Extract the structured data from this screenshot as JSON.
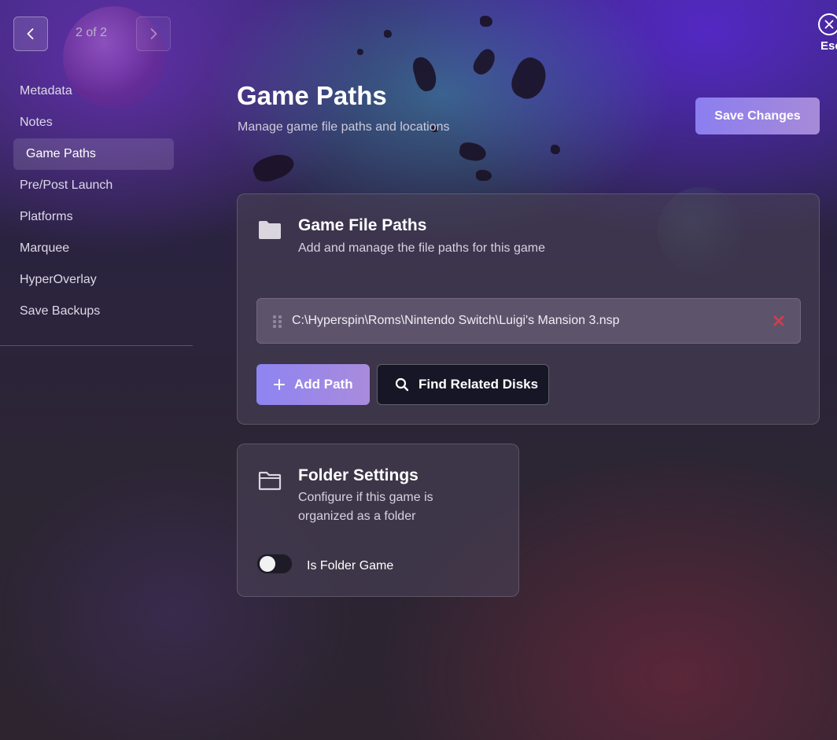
{
  "nav": {
    "counter": "2 of 2",
    "esc_label": "Esc"
  },
  "sidebar": {
    "items": [
      {
        "label": "Metadata"
      },
      {
        "label": "Notes"
      },
      {
        "label": "Game Paths",
        "active": true
      },
      {
        "label": "Pre/Post Launch"
      },
      {
        "label": "Platforms"
      },
      {
        "label": "Marquee"
      },
      {
        "label": "HyperOverlay"
      },
      {
        "label": "Save Backups"
      }
    ]
  },
  "header": {
    "title": "Game Paths",
    "subtitle": "Manage game file paths and locations",
    "save_label": "Save Changes"
  },
  "paths_card": {
    "title": "Game File Paths",
    "description": "Add and manage the file paths for this game",
    "paths": [
      "C:\\Hyperspin\\Roms\\Nintendo Switch\\Luigi's Mansion 3.nsp"
    ],
    "add_label": "Add Path",
    "find_label": "Find Related Disks"
  },
  "folder_card": {
    "title": "Folder Settings",
    "description_line1": "Configure if this game is",
    "description_line2": "organized as a folder",
    "toggle_label": "Is Folder Game",
    "toggle_on": false
  },
  "colors": {
    "accent": "#8b7ef0",
    "remove": "#e0394a"
  }
}
